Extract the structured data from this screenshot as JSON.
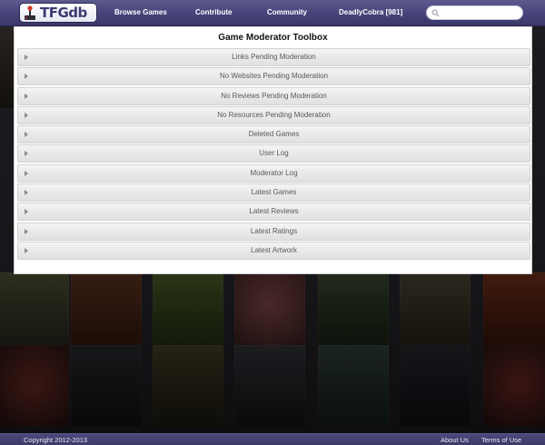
{
  "header": {
    "logo_text": "TFGdb",
    "nav": [
      {
        "label": "Browse Games"
      },
      {
        "label": "Contribute"
      },
      {
        "label": "Community"
      }
    ],
    "user_label": "DeadlyCobra [981]",
    "search": {
      "placeholder": "",
      "value": ""
    }
  },
  "panel": {
    "title": "Game Moderator Toolbox",
    "items": [
      {
        "label": "Links Pending Moderation"
      },
      {
        "label": "No Websites Pending Moderation"
      },
      {
        "label": "No Reviews Pending Moderation"
      },
      {
        "label": "No Resources Pending Moderation"
      },
      {
        "label": "Deleted Games"
      },
      {
        "label": "User Log"
      },
      {
        "label": "Moderator Log"
      },
      {
        "label": "Latest Games"
      },
      {
        "label": "Latest Reviews"
      },
      {
        "label": "Latest Ratings"
      },
      {
        "label": "Latest Artwork"
      }
    ]
  },
  "footer": {
    "copyright": "Copyright 2012-2013",
    "about": "About Us",
    "terms": "Terms of Use"
  },
  "colors": {
    "header": "#46437a",
    "footer": "#3b3967",
    "panel": "#ffffff",
    "accordion": "#e9e9e9"
  }
}
